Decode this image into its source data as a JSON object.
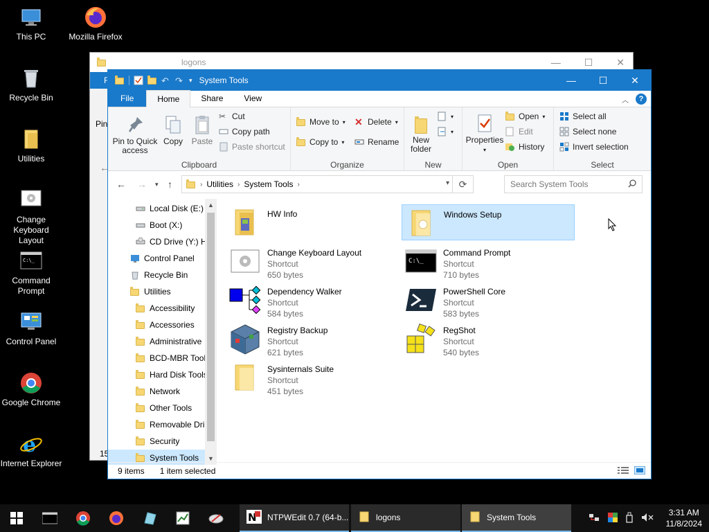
{
  "desktop": {
    "icons": [
      {
        "label": "This PC",
        "icon": "computer-icon"
      },
      {
        "label": "Mozilla Firefox",
        "icon": "firefox-icon"
      },
      {
        "label": "Recycle Bin",
        "icon": "recycle-bin-icon"
      },
      {
        "label": "Utilities",
        "icon": "folder-icon"
      },
      {
        "label": "Change Keyboard Layout",
        "icon": "keyboard-icon"
      },
      {
        "label": "Command Prompt",
        "icon": "cmd-icon"
      },
      {
        "label": "Control Panel",
        "icon": "control-panel-icon"
      },
      {
        "label": "Google Chrome",
        "icon": "chrome-icon"
      },
      {
        "label": "Internet Explorer",
        "icon": "ie-icon"
      }
    ]
  },
  "back_window": {
    "title": "logons",
    "tab_letter": "F",
    "side_text": "Pin",
    "bottom_text": "15"
  },
  "window": {
    "title": "System Tools",
    "controls": {
      "minimize": "—",
      "maximize": "☐",
      "close": "✕"
    },
    "tabs": [
      {
        "label": "File"
      },
      {
        "label": "Home"
      },
      {
        "label": "Share"
      },
      {
        "label": "View"
      }
    ],
    "ribbon": {
      "clipboard": {
        "label": "Clipboard",
        "pin": "Pin to Quick access",
        "pin_line1": "Pin to Quick",
        "pin_line2": "access",
        "copy": "Copy",
        "paste": "Paste",
        "cut": "Cut",
        "copy_path": "Copy path",
        "paste_shortcut": "Paste shortcut"
      },
      "organize": {
        "label": "Organize",
        "move_to": "Move to",
        "copy_to": "Copy to",
        "delete": "Delete",
        "rename": "Rename"
      },
      "new": {
        "label": "New",
        "new_folder_line1": "New",
        "new_folder_line2": "folder"
      },
      "open": {
        "label": "Open",
        "properties": "Properties",
        "open": "Open",
        "edit": "Edit",
        "history": "History"
      },
      "select": {
        "label": "Select",
        "select_all": "Select all",
        "select_none": "Select none",
        "invert": "Invert selection"
      }
    },
    "address": {
      "crumbs": [
        "Utilities",
        "System Tools"
      ],
      "search_placeholder": "Search System Tools"
    },
    "nav_pane": [
      {
        "label": "Local Disk (E:)",
        "icon": "drive-icon",
        "indent": 2
      },
      {
        "label": "Boot (X:)",
        "icon": "drive-icon",
        "indent": 2
      },
      {
        "label": "CD Drive (Y:) H",
        "icon": "cd-drive-icon",
        "indent": 2
      },
      {
        "label": "Control Panel",
        "icon": "control-panel-icon",
        "indent": 1
      },
      {
        "label": "Recycle Bin",
        "icon": "recycle-bin-icon",
        "indent": 1
      },
      {
        "label": "Utilities",
        "icon": "folder-icon",
        "indent": 1
      },
      {
        "label": "Accessibility",
        "icon": "folder-icon",
        "indent": 2
      },
      {
        "label": "Accessories",
        "icon": "folder-icon",
        "indent": 2
      },
      {
        "label": "Administrative",
        "icon": "folder-icon",
        "indent": 2
      },
      {
        "label": "BCD-MBR Tool",
        "icon": "folder-icon",
        "indent": 2
      },
      {
        "label": "Hard Disk Tools",
        "icon": "folder-icon",
        "indent": 2
      },
      {
        "label": "Network",
        "icon": "folder-icon",
        "indent": 2
      },
      {
        "label": "Other Tools",
        "icon": "folder-icon",
        "indent": 2
      },
      {
        "label": "Removable Dri",
        "icon": "folder-icon",
        "indent": 2
      },
      {
        "label": "Security",
        "icon": "folder-icon",
        "indent": 2
      },
      {
        "label": "System Tools",
        "icon": "folder-icon",
        "indent": 2,
        "selected": true
      }
    ],
    "files": [
      {
        "name": "HW Info",
        "type": "",
        "size": "",
        "icon": "hw-info-folder-icon"
      },
      {
        "name": "Windows Setup",
        "type": "",
        "size": "",
        "icon": "windows-setup-folder-icon",
        "selected": true
      },
      {
        "name": "Change Keyboard Layout",
        "type": "Shortcut",
        "size": "650 bytes",
        "icon": "keyboard-icon"
      },
      {
        "name": "Command Prompt",
        "type": "Shortcut",
        "size": "710 bytes",
        "icon": "cmd-icon"
      },
      {
        "name": "Dependency Walker",
        "type": "Shortcut",
        "size": "584 bytes",
        "icon": "dependency-walker-icon"
      },
      {
        "name": "PowerShell Core",
        "type": "Shortcut",
        "size": "583 bytes",
        "icon": "powershell-icon"
      },
      {
        "name": "Registry Backup",
        "type": "Shortcut",
        "size": "621 bytes",
        "icon": "registry-cube-icon"
      },
      {
        "name": "RegShot",
        "type": "Shortcut",
        "size": "540 bytes",
        "icon": "regshot-icon"
      },
      {
        "name": "Sysinternals Suite",
        "type": "Shortcut",
        "size": "451 bytes",
        "icon": "folder-icon"
      }
    ],
    "status": {
      "items": "9 items",
      "selected": "1 item selected"
    }
  },
  "taskbar": {
    "apps": [
      {
        "label": "NTPWEdit 0.7 (64-b...",
        "icon": "ntpwedit-icon"
      },
      {
        "label": "logons",
        "icon": "folder-icon"
      },
      {
        "label": "System Tools",
        "icon": "folder-icon",
        "active": true
      }
    ],
    "time": "3:31 AM",
    "date": "11/8/2024"
  },
  "colors": {
    "accent": "#1979ca",
    "selection": "#cce8ff",
    "folder": "#f7d774"
  }
}
